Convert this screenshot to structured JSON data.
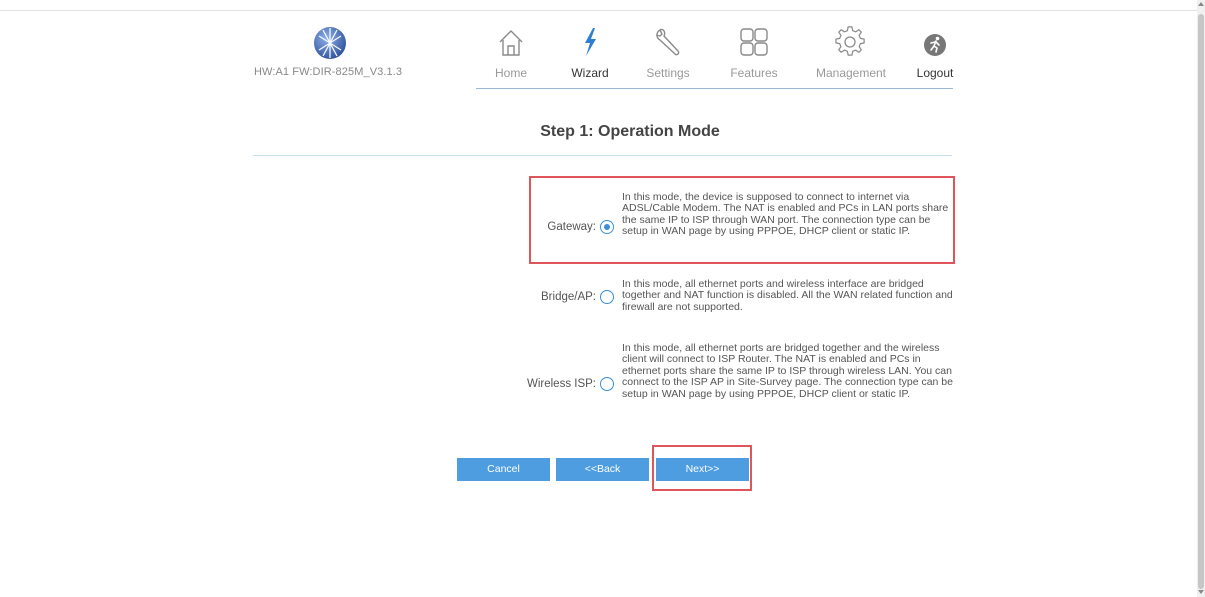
{
  "header": {
    "firmware": "HW:A1 FW:DIR-825M_V3.1.3"
  },
  "nav": [
    {
      "label": "Home",
      "icon": "home-icon"
    },
    {
      "label": "Wizard",
      "icon": "lightning-icon"
    },
    {
      "label": "Settings",
      "icon": "wrench-icon"
    },
    {
      "label": "Features",
      "icon": "grid-icon"
    },
    {
      "label": "Management",
      "icon": "gear-icon"
    },
    {
      "label": "Logout",
      "icon": "running-man-icon"
    }
  ],
  "colors": {
    "accent": "#4d9de0",
    "highlight": "#e05559",
    "wizard_icon": "#2f7fd1"
  },
  "page": {
    "title": "Step 1: Operation Mode"
  },
  "options": [
    {
      "label": "Gateway:",
      "checked": true,
      "description": "In this mode, the device is supposed to connect to internet via ADSL/Cable Modem. The NAT is enabled and PCs in LAN ports share the same IP to ISP through WAN port. The connection type can be setup in WAN page by using PPPOE, DHCP client or static IP."
    },
    {
      "label": "Bridge/AP:",
      "checked": false,
      "description": "In this mode, all ethernet ports and wireless interface are bridged together and NAT function is disabled. All the WAN related function and firewall are not supported."
    },
    {
      "label": "Wireless ISP:",
      "checked": false,
      "description": "In this mode, all ethernet ports are bridged together and the wireless client will connect to ISP Router. The NAT is enabled and PCs in ethernet ports share the same IP to ISP through wireless LAN. You can connect to the ISP AP in Site-Survey page. The connection type can be setup in WAN page by using PPPOE, DHCP client or static IP."
    }
  ],
  "buttons": {
    "cancel": "Cancel",
    "back": "<<Back",
    "next": "Next>>"
  }
}
